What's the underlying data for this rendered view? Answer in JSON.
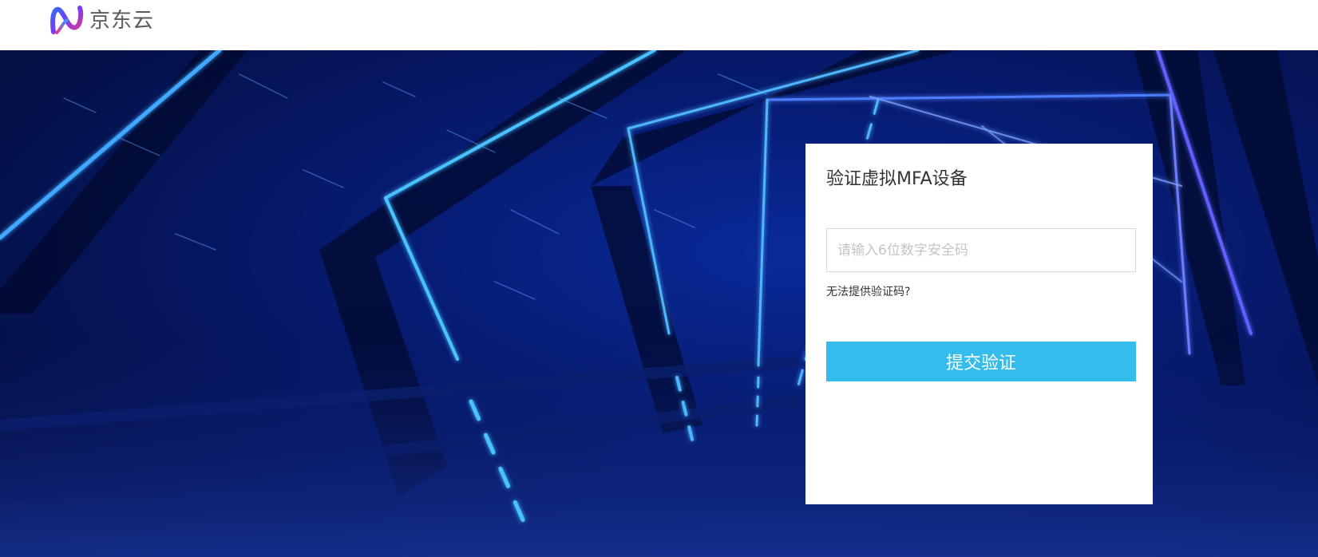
{
  "header": {
    "logo_text": "京东云",
    "logo_icon": "jd-cloud-logo-icon"
  },
  "panel": {
    "title": "验证虚拟MFA设备",
    "code_input": {
      "value": "",
      "placeholder": "请输入6位数字安全码"
    },
    "help_link": "无法提供验证码?",
    "submit_label": "提交验证"
  },
  "colors": {
    "accent": "#34bdec",
    "background_dark": "#04114a",
    "neon_blue": "#3aa8ff",
    "neon_violet": "#5a55ff"
  }
}
